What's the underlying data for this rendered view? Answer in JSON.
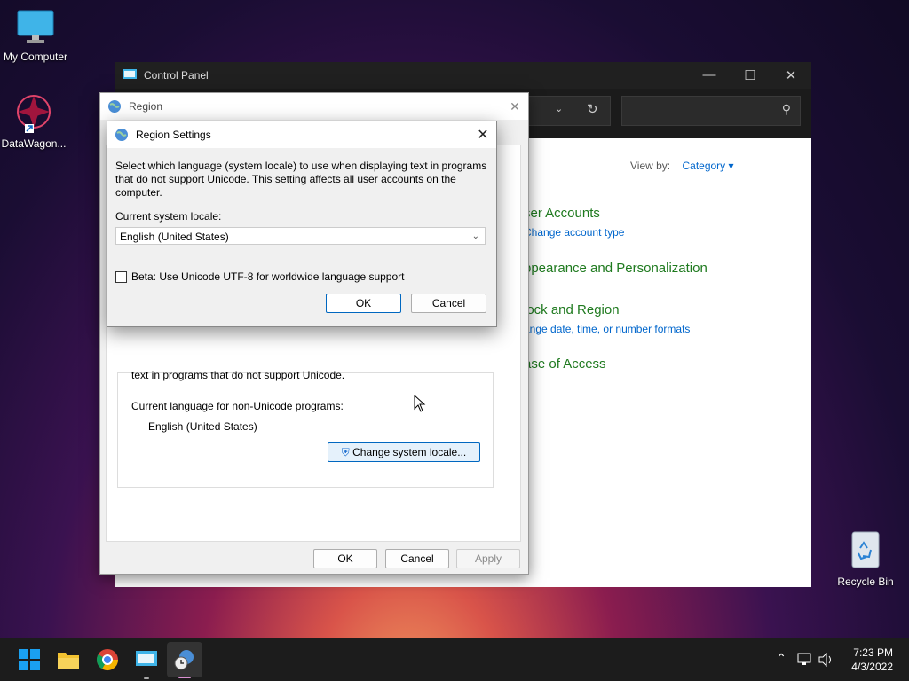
{
  "desktop": {
    "icons": [
      {
        "label": "My Computer",
        "icon": "monitor-icon"
      },
      {
        "label": "DataWagon...",
        "icon": "app-shortcut-icon"
      },
      {
        "label": "Recycle Bin",
        "icon": "recycle-bin-icon"
      }
    ]
  },
  "control_panel": {
    "title": "Control Panel",
    "view_by_label": "View by:",
    "view_by_value": "Category",
    "categories": [
      {
        "heading": "ser Accounts",
        "sub": "Change account type"
      },
      {
        "heading": "ppearance and Personalization",
        "sub": ""
      },
      {
        "heading": "lock and Region",
        "sub": "ange date, time, or number formats"
      },
      {
        "heading": "ase of Access",
        "sub": ""
      }
    ]
  },
  "region": {
    "title": "Region",
    "partial_text": "text in programs that do not support Unicode.",
    "current_lang_label": "Current language for non-Unicode programs:",
    "current_lang_value": "English (United States)",
    "change_locale_btn": "Change system locale...",
    "ok": "OK",
    "cancel": "Cancel",
    "apply": "Apply"
  },
  "region_settings": {
    "title": "Region Settings",
    "description": "Select which language (system locale) to use when displaying text in programs that do not support Unicode. This setting affects all user accounts on the computer.",
    "locale_label": "Current system locale:",
    "locale_value": "English (United States)",
    "beta_label": "Beta: Use Unicode UTF-8 for worldwide language support",
    "beta_checked": false,
    "ok": "OK",
    "cancel": "Cancel"
  },
  "taskbar": {
    "time": "7:23 PM",
    "date": "4/3/2022"
  }
}
